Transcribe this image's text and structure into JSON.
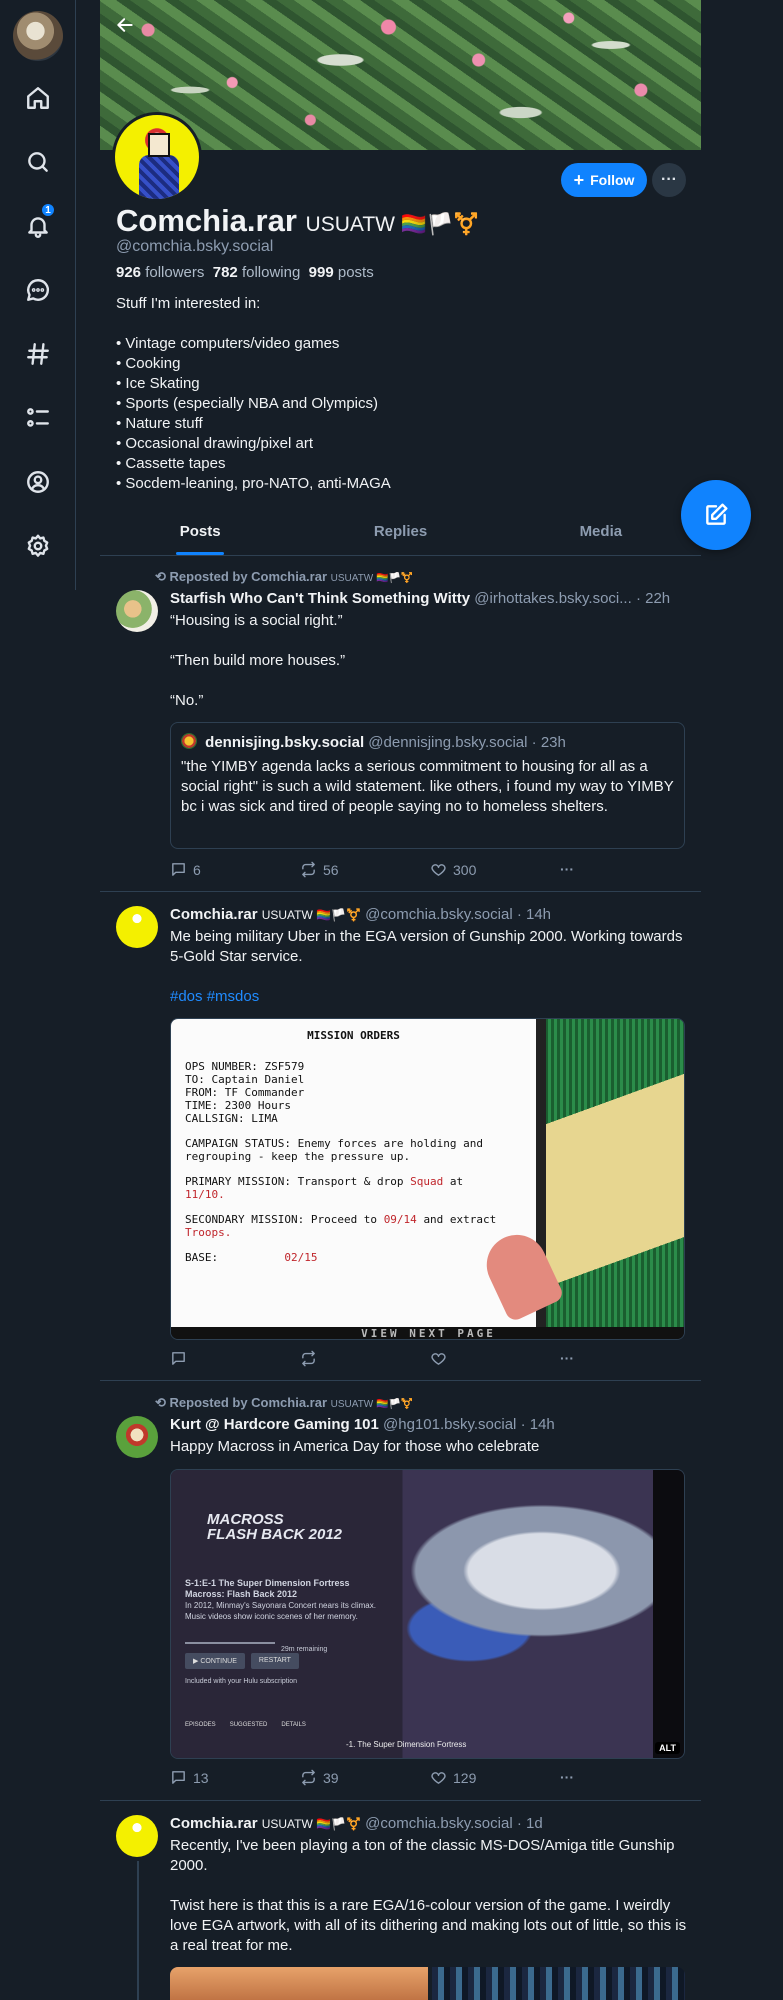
{
  "nav": {
    "notifications_badge": "1",
    "items": [
      "home-icon",
      "search-icon",
      "bell-icon",
      "chat-icon",
      "hashtag-icon",
      "list-icon",
      "profile-icon",
      "settings-icon"
    ]
  },
  "profile": {
    "display_name": "Comchia.rar",
    "name_suffix": "USUATW 🏳️‍🌈🏳️⚧️",
    "handle": "@comchia.bsky.social",
    "followers_count": "926",
    "followers_label": "followers",
    "following_count": "782",
    "following_label": "following",
    "posts_count": "999",
    "posts_label": "posts",
    "follow_label": "Follow",
    "more_label": "···",
    "bio": [
      "Stuff I'm interested in:",
      "",
      "• Vintage computers/video games",
      "• Cooking",
      "• Ice Skating",
      "• Sports (especially NBA and Olympics)",
      "• Nature stuff",
      "• Occasional drawing/pixel art",
      "• Cassette tapes",
      "• Socdem-leaning, pro-NATO, anti-MAGA"
    ]
  },
  "tabs": [
    "Posts",
    "Replies",
    "Media"
  ],
  "posts": [
    {
      "repost_by": "Reposted by Comchia.rar",
      "repost_suffix": "USUATW 🏳️‍🌈🏳️⚧️",
      "author": "Starfish Who Can't Think Something Witty",
      "handle": "@irhottakes.bsky.soci...",
      "time": "· 22h",
      "text": [
        "“Housing is a social right.”",
        "",
        "“Then build more houses.”",
        "",
        "“No.”"
      ],
      "quote": {
        "author": "dennisjing.bsky.social",
        "handle": "@dennisjing.bsky.social",
        "time": "· 23h",
        "text": "\"the YIMBY agenda lacks a serious commitment to housing for all as a social right\" is such a wild statement. like others, i found my way to YIMBY bc i was sick and tired of people saying no to homeless shelters."
      },
      "replies": "6",
      "reposts": "56",
      "likes": "300"
    },
    {
      "author": "Comchia.rar",
      "author_suffix": "USUATW 🏳️‍🌈🏳️⚧️",
      "handle": "@comchia.bsky.social",
      "time": "· 14h",
      "text": [
        "Me being military Uber in the EGA version of Gunship 2000. Working towards 5-Gold Star service."
      ],
      "tags": "#dos #msdos",
      "image": {
        "title": "MISSION ORDERS",
        "ops_number": "OPS NUMBER:  ZSF579",
        "to": "TO:          Captain Daniel",
        "from": "FROM:        TF Commander",
        "time": "TIME:        2300 Hours",
        "callsign": "CALLSIGN:    LIMA",
        "campaign_1": "CAMPAIGN STATUS:   Enemy forces are holding and",
        "campaign_2": "regrouping - keep the pressure up.",
        "primary_1": "PRIMARY MISSION:   Transport & drop",
        "primary_squad": "Squad",
        "primary_at": "at",
        "primary_loc": "11/10.",
        "secondary_1": "SECONDARY MISSION: Proceed to",
        "secondary_loc": "09/14",
        "secondary_2": "and extract",
        "secondary_troops": "Troops.",
        "base_label": "BASE:",
        "base_loc": "02/15",
        "footer": "VIEW NEXT PAGE"
      },
      "replies": "",
      "reposts": "",
      "likes": ""
    },
    {
      "repost_by": "Reposted by Comchia.rar",
      "repost_suffix": "USUATW 🏳️‍🌈🏳️⚧️",
      "author": "Kurt @ Hardcore Gaming 101",
      "handle": "@hg101.bsky.social",
      "time": "· 14h",
      "text": [
        "Happy Macross in America Day for those who celebrate"
      ],
      "image": {
        "title_1": "MACROSS",
        "title_2": "FLASH BACK 2012",
        "ep_title": "S-1:E-1 The Super Dimension Fortress Macross: Flash Back 2012",
        "ep_desc": "In 2012, Minmay's Sayonara Concert nears its climax. Music videos show iconic scenes of her memory.",
        "remaining": "29m remaining",
        "continue": "▶ CONTINUE",
        "restart": "RESTART",
        "subscription": "Included with your Hulu subscription",
        "tab_episodes": "EPISODES",
        "tab_suggested": "SUGGESTED",
        "tab_details": "DETAILS",
        "ep_line": "-1. The Super Dimension Fortress",
        "alt": "ALT"
      },
      "replies": "13",
      "reposts": "39",
      "likes": "129"
    },
    {
      "author": "Comchia.rar",
      "author_suffix": "USUATW 🏳️‍🌈🏳️⚧️",
      "handle": "@comchia.bsky.social",
      "time": "· 1d",
      "text": [
        "Recently, I've been playing a ton of the classic MS-DOS/Amiga title Gunship 2000.",
        "",
        "Twist here is that this is a rare EGA/16-colour version of the game. I weirdly love EGA artwork, with all of its dithering and making lots out of little, so this is a real treat for me."
      ]
    }
  ],
  "more_label": "···",
  "colors": {
    "accent": "#1083fe",
    "background": "#161e27",
    "border": "#2e4052",
    "muted": "#8d9cb0"
  }
}
